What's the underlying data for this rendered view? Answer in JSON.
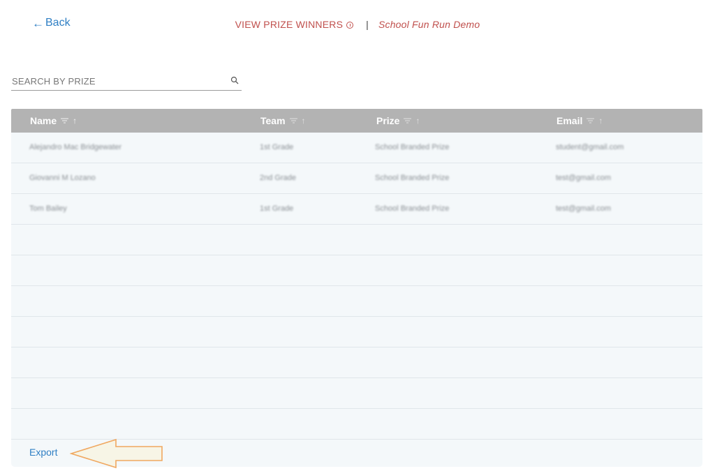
{
  "nav": {
    "back_label": "Back"
  },
  "header": {
    "title": "VIEW PRIZE WINNERS",
    "separator": "|",
    "event_name": "School Fun Run Demo"
  },
  "search": {
    "placeholder": "SEARCH BY PRIZE",
    "value": ""
  },
  "table": {
    "columns": [
      "Name",
      "Team",
      "Prize",
      "Email"
    ],
    "rows": [
      {
        "name": "Alejandro Mac Bridgewater",
        "team": "1st Grade",
        "prize": "School Branded Prize",
        "email": "student@gmail.com"
      },
      {
        "name": "Giovanni M Lozano",
        "team": "2nd Grade",
        "prize": "School Branded Prize",
        "email": "test@gmail.com"
      },
      {
        "name": "Tom Bailey",
        "team": "1st Grade",
        "prize": "School Branded Prize",
        "email": "test@gmail.com"
      }
    ],
    "empty_rows": 7
  },
  "footer": {
    "export_label": "Export"
  },
  "colors": {
    "accent_blue": "#2f7fc4",
    "header_red": "#c0504d",
    "table_header_bg": "#b3b3b3",
    "annotation_arrow": "#f0a860"
  }
}
